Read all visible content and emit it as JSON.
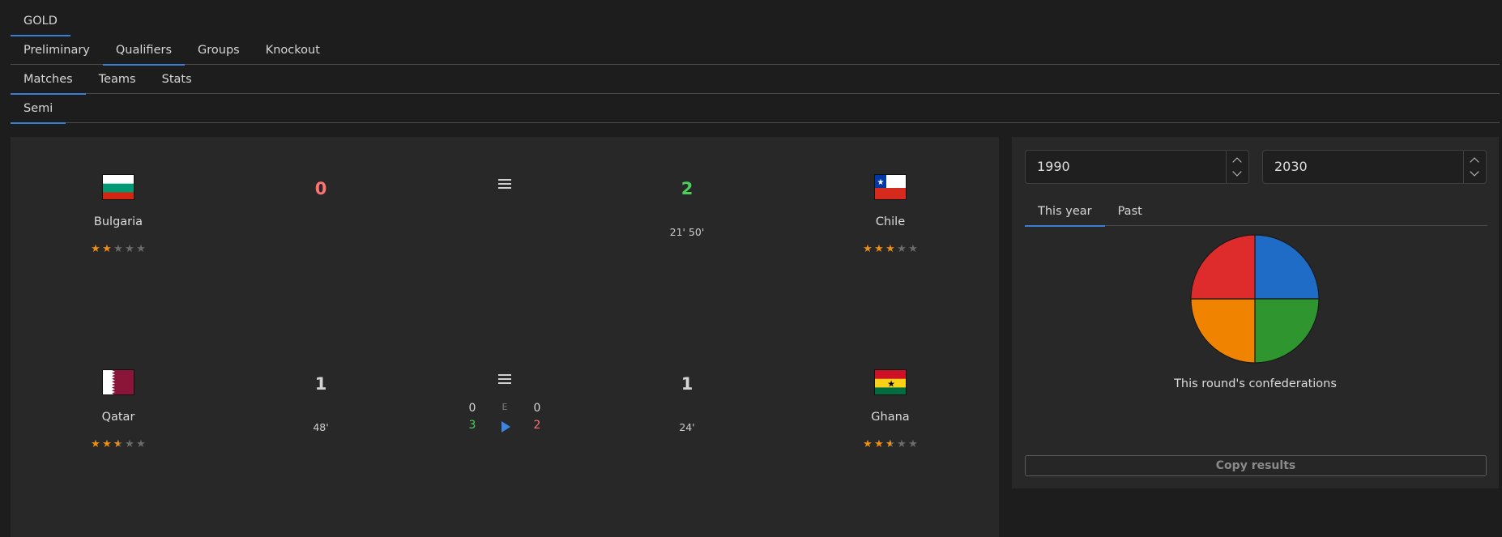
{
  "tabs_level1": [
    {
      "label": "GOLD",
      "active": true
    }
  ],
  "tabs_level2": [
    {
      "label": "Preliminary",
      "active": false
    },
    {
      "label": "Qualifiers",
      "active": true
    },
    {
      "label": "Groups",
      "active": false
    },
    {
      "label": "Knockout",
      "active": false
    }
  ],
  "tabs_level3": [
    {
      "label": "Matches",
      "active": true
    },
    {
      "label": "Teams",
      "active": false
    },
    {
      "label": "Stats",
      "active": false
    }
  ],
  "tabs_level4": [
    {
      "label": "Semi",
      "active": true
    }
  ],
  "matches": [
    {
      "home": {
        "name": "Bulgaria",
        "flag": "bulgaria-flag",
        "rating": 2,
        "score": "0",
        "score_color": "#ff7373",
        "goal_times": ""
      },
      "away": {
        "name": "Chile",
        "flag": "chile-flag",
        "rating": 3,
        "score": "2",
        "score_color": "#4cce5a",
        "goal_times": "21' 50'"
      },
      "penalties": null
    },
    {
      "home": {
        "name": "Qatar",
        "flag": "qatar-flag",
        "rating": 2.5,
        "score": "1",
        "score_color": "#d4d4d4",
        "goal_times": "48'"
      },
      "away": {
        "name": "Ghana",
        "flag": "ghana-flag",
        "rating": 2.5,
        "score": "1",
        "score_color": "#d4d4d4",
        "goal_times": "24'"
      },
      "penalties": {
        "label": "E",
        "home_top": "0",
        "away_top": "0",
        "home_pens": "3",
        "away_pens": "2",
        "home_pens_color": "#4cce5a",
        "away_pens_color": "#ff7373"
      }
    }
  ],
  "filters": {
    "year_from": "1990",
    "year_to": "2030"
  },
  "stats_tabs": [
    {
      "label": "This year",
      "active": true
    },
    {
      "label": "Past",
      "active": false
    }
  ],
  "chart_data": {
    "type": "pie",
    "title": "This round's confederations",
    "slices": [
      {
        "value": 1,
        "color": "#1f6cc7"
      },
      {
        "value": 1,
        "color": "#2f962f"
      },
      {
        "value": 1,
        "color": "#f08400"
      },
      {
        "value": 1,
        "color": "#de2b2b"
      }
    ],
    "start_angle_deg": 0,
    "direction": "clockwise"
  },
  "actions": {
    "copy_label": "Copy results"
  },
  "colors": {
    "accent": "#3b7fd4",
    "star_on": "#ef8f11",
    "star_off": "#6b6b6b"
  }
}
